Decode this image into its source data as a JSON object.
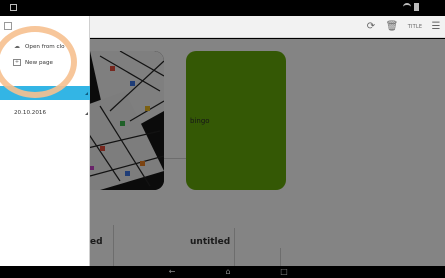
{
  "drawer": {
    "items": [
      {
        "label": "Open from clo",
        "icon": "cloud-icon"
      },
      {
        "label": "New page",
        "icon": "new-page-icon"
      }
    ],
    "date": "20.10.2016"
  },
  "toolbar": {
    "title_label": "TITLE"
  },
  "cards": [
    {
      "title": "untitled",
      "visible_title": "ed",
      "type": "photo"
    },
    {
      "title": "untitled",
      "type": "text",
      "text": "bingo",
      "color": "#5fa00a"
    }
  ],
  "bottom_titles": [
    "ed",
    "untitled"
  ],
  "colors": {
    "drawer_selection": "#33b5e5",
    "highlight_ring": "#f6c08f",
    "card_green": "#5fa00a"
  }
}
